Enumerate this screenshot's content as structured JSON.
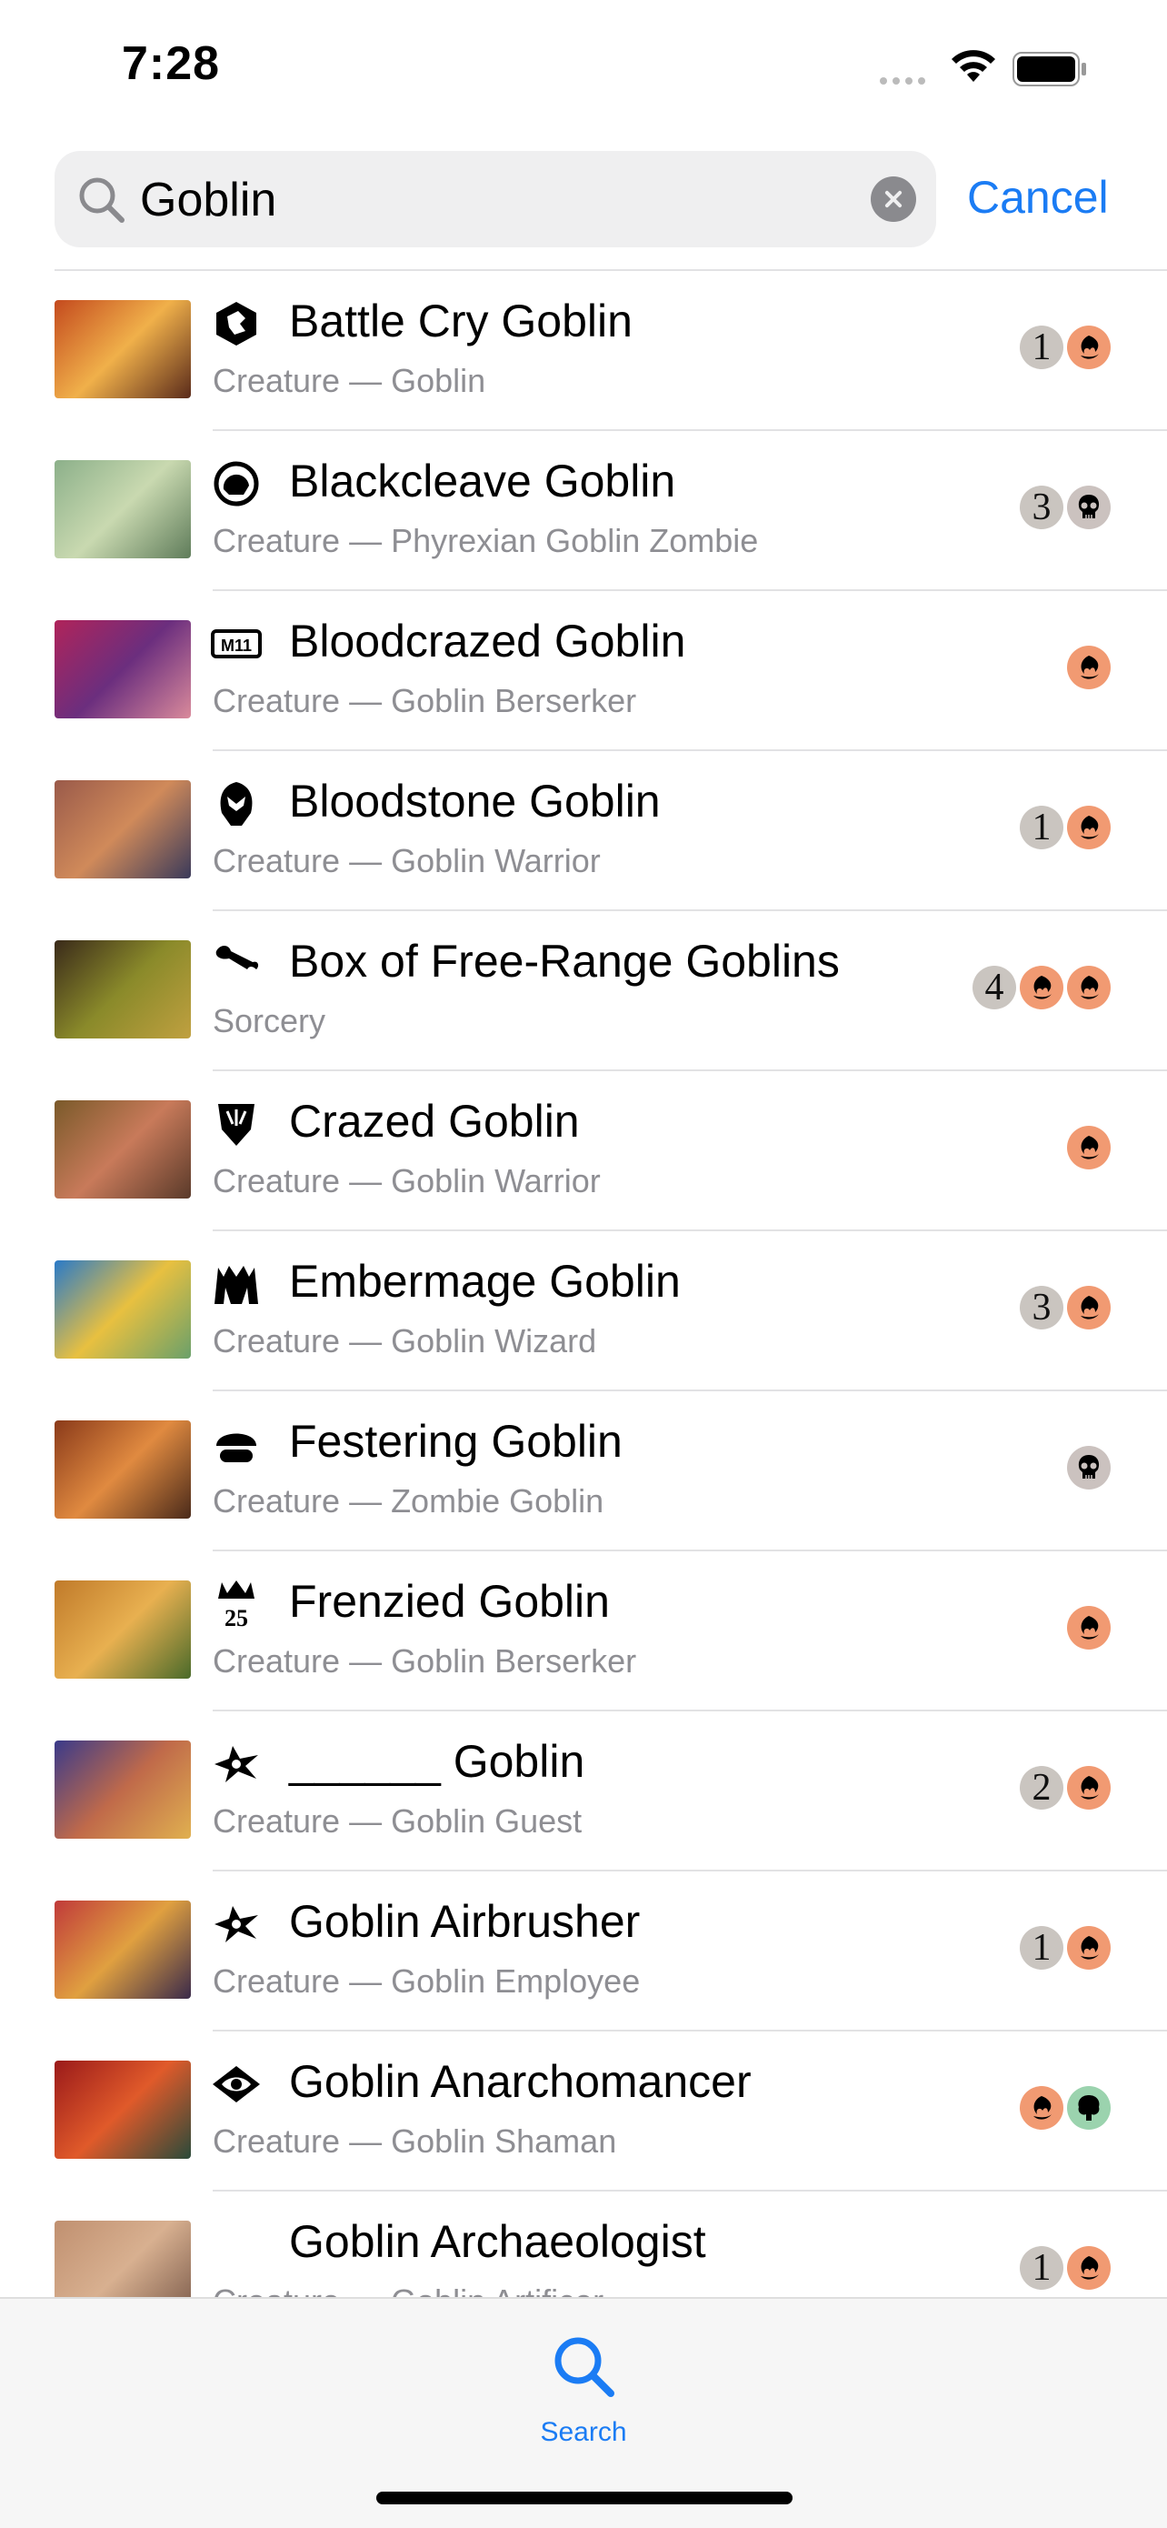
{
  "status_bar": {
    "time": "7:28"
  },
  "search": {
    "value": "Goblin",
    "cancel_label": "Cancel"
  },
  "colors": {
    "accent": "#1b7cf4",
    "red_mana": "#f19a72",
    "black_mana": "#cbc2bf",
    "green_mana": "#9bd3ae",
    "generic_mana": "#cac5c0"
  },
  "results": [
    {
      "name": "Battle Cry Goblin",
      "type": "Creature — Goblin",
      "set_icon": "lion-crest-icon",
      "cost": [
        {
          "kind": "generic",
          "value": "1"
        },
        {
          "kind": "red",
          "value": ""
        }
      ]
    },
    {
      "name": "Blackcleave Goblin",
      "type": "Creature — Phyrexian Goblin Zombie",
      "set_icon": "phyrexian-ring-icon",
      "cost": [
        {
          "kind": "generic",
          "value": "3"
        },
        {
          "kind": "black",
          "value": ""
        }
      ]
    },
    {
      "name": "Bloodcrazed Goblin",
      "type": "Creature — Goblin Berserker",
      "set_icon": "m11-ticket-icon",
      "cost": [
        {
          "kind": "red",
          "value": ""
        }
      ]
    },
    {
      "name": "Bloodstone Goblin",
      "type": "Creature — Goblin Warrior",
      "set_icon": "dominaria-helm-icon",
      "cost": [
        {
          "kind": "generic",
          "value": "1"
        },
        {
          "kind": "red",
          "value": ""
        }
      ]
    },
    {
      "name": "Box of Free-Range Goblins",
      "type": "Sorcery",
      "set_icon": "wrench-icon",
      "cost": [
        {
          "kind": "generic",
          "value": "4"
        },
        {
          "kind": "red",
          "value": ""
        },
        {
          "kind": "red",
          "value": ""
        }
      ]
    },
    {
      "name": "Crazed Goblin",
      "type": "Creature — Goblin Warrior",
      "set_icon": "shield-claw-icon",
      "cost": [
        {
          "kind": "red",
          "value": ""
        }
      ]
    },
    {
      "name": "Embermage Goblin",
      "type": "Creature — Goblin Wizard",
      "set_icon": "gate-icon",
      "cost": [
        {
          "kind": "generic",
          "value": "3"
        },
        {
          "kind": "red",
          "value": ""
        }
      ]
    },
    {
      "name": "Festering Goblin",
      "type": "Creature — Zombie Goblin",
      "set_icon": "mushroom-icon",
      "cost": [
        {
          "kind": "black",
          "value": ""
        }
      ]
    },
    {
      "name": "Frenzied Goblin",
      "type": "Creature — Goblin Berserker",
      "set_icon": "crown-25-icon",
      "cost": [
        {
          "kind": "red",
          "value": ""
        }
      ]
    },
    {
      "name": "______ Goblin",
      "type": "Creature — Goblin Guest",
      "set_icon": "star-splat-icon",
      "cost": [
        {
          "kind": "generic",
          "value": "2"
        },
        {
          "kind": "red",
          "value": ""
        }
      ]
    },
    {
      "name": "Goblin Airbrusher",
      "type": "Creature — Goblin Employee",
      "set_icon": "star-splat-icon",
      "cost": [
        {
          "kind": "generic",
          "value": "1"
        },
        {
          "kind": "red",
          "value": ""
        }
      ]
    },
    {
      "name": "Goblin Anarchomancer",
      "type": "Creature — Goblin Shaman",
      "set_icon": "guild-eye-icon",
      "cost": [
        {
          "kind": "red",
          "value": ""
        },
        {
          "kind": "green",
          "value": ""
        }
      ]
    },
    {
      "name": "Goblin Archaeologist",
      "type": "Creature — Goblin Artificer",
      "set_icon": "",
      "cost": [
        {
          "kind": "generic",
          "value": "1"
        },
        {
          "kind": "red",
          "value": ""
        }
      ]
    }
  ],
  "tab_bar": {
    "search_label": "Search"
  }
}
